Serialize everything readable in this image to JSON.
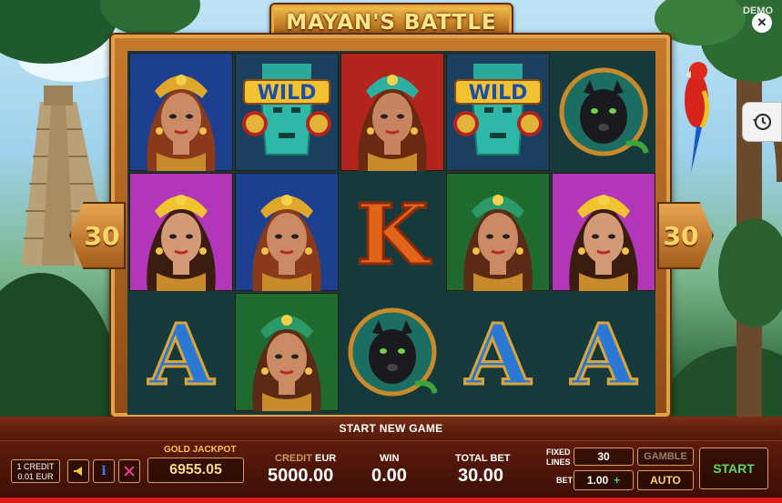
{
  "game": {
    "title": "MAYAN'S BATTLE",
    "demo_label": "DEMO",
    "close_icon": "close-icon",
    "history_icon": "history-icon"
  },
  "paylines": {
    "left": "30",
    "right": "30"
  },
  "reels": {
    "columns": [
      [
        "woman-blue",
        "woman-purple",
        "letter-A"
      ],
      [
        "wild",
        "woman-blue",
        "woman-green"
      ],
      [
        "woman-red",
        "letter-K",
        "panther"
      ],
      [
        "wild",
        "woman-green",
        "letter-A"
      ],
      [
        "panther",
        "woman-purple",
        "letter-A"
      ]
    ],
    "wild_text": "WILD",
    "letters": {
      "A": "A",
      "K": "K"
    }
  },
  "message": "START NEW GAME",
  "panel": {
    "credit_info_line1": "1 CREDIT",
    "credit_info_line2": "0.01 EUR",
    "gold_jackpot_label": "GOLD JACKPOT",
    "gold_jackpot_value": "6955.05",
    "credit_label": "CREDIT",
    "credit_currency": "EUR",
    "credit_value": "5000.00",
    "win_label": "WIN",
    "win_value": "0.00",
    "total_bet_label": "TOTAL BET",
    "total_bet_value": "30.00",
    "fixed_lines_label": "FIXED LINES",
    "fixed_lines_value": "30",
    "bet_label": "BET",
    "bet_value": "1.00",
    "bet_plus": "+",
    "gamble_label": "GAMBLE",
    "auto_label": "AUTO",
    "start_label": "START"
  },
  "colors": {
    "accent_gold": "#f7d98a",
    "start_green": "#5bd85f",
    "stripe_red": "#e01818"
  }
}
